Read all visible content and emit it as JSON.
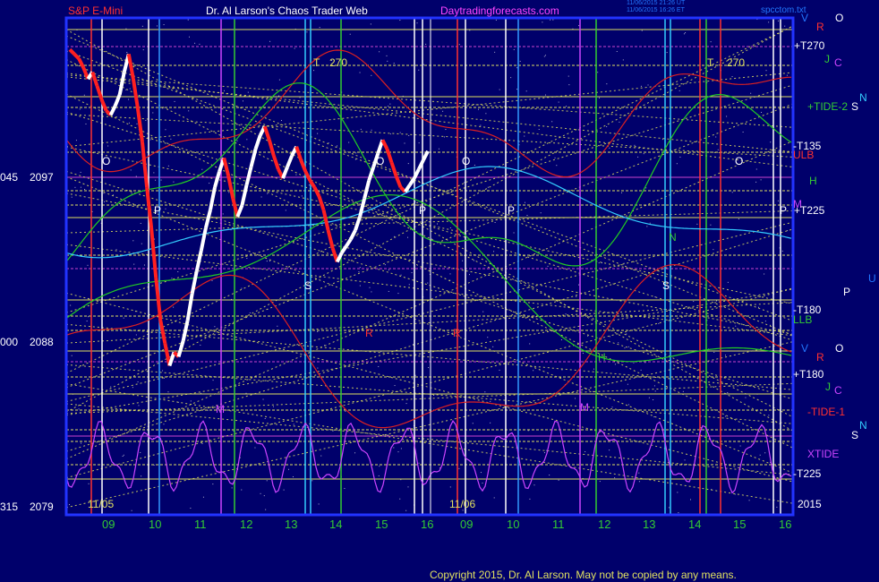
{
  "header": {
    "symbol": "S&P E-Mini",
    "title": "Dr. Al Larson's Chaos Trader Web",
    "site": "Daytradingforecasts.com",
    "timestamp_line1": "11/06/2015 21:26 UT",
    "timestamp_line2": "11/06/2015 16:26 ET",
    "file": "spcctom.txt"
  },
  "copyright": "Copyright 2015, Dr. Al Larson. May not be copied by any means.",
  "colors": {
    "background": "#00006b",
    "plot_border": "#2233ff",
    "grid_yellow": "#e0e060",
    "price_white": "#ffffff",
    "price_red": "#ff2020",
    "magenta": "#cc44ff",
    "red_line": "#dd2020",
    "green_line": "#22cc22",
    "cyan_line": "#33ccff"
  },
  "chart_data": {
    "type": "line",
    "title": "Dr. Al Larson's Chaos Trader Web",
    "ylabel": "",
    "y_ticks": [
      {
        "left": "045",
        "right": "2097"
      },
      {
        "left": "000",
        "right": "2088"
      },
      {
        "left": "315",
        "right": "2079"
      }
    ],
    "ylim": [
      2079,
      2101
    ],
    "x_tick_labels": [
      "09",
      "10",
      "11",
      "12",
      "13",
      "14",
      "15",
      "16",
      "09",
      "10",
      "11",
      "12",
      "13",
      "14",
      "15",
      "16"
    ],
    "date_labels": [
      "11/05",
      "11/06"
    ],
    "year_label": "2015",
    "price_series": {
      "name": "S&P E-Mini",
      "values": [
        2099.6,
        2099.4,
        2099.2,
        2098.8,
        2098.3,
        2098.6,
        2098.0,
        2097.4,
        2096.9,
        2096.7,
        2097.1,
        2097.6,
        2098.6,
        2099.4,
        2098.3,
        2097.0,
        2095.5,
        2093.5,
        2091.7,
        2089.5,
        2087.6,
        2086.6,
        2085.6,
        2086.2,
        2086.0,
        2086.7,
        2087.6,
        2088.8,
        2089.8,
        2090.7,
        2091.7,
        2092.5,
        2093.5,
        2094.2,
        2094.8,
        2094.0,
        2093.0,
        2092.2,
        2092.7,
        2093.6,
        2094.4,
        2095.2,
        2095.8,
        2096.2,
        2095.6,
        2094.9,
        2094.3,
        2093.9,
        2094.4,
        2094.9,
        2095.3,
        2094.7,
        2094.2,
        2093.8,
        2093.5,
        2093.1,
        2092.5,
        2091.6,
        2090.8,
        2090.2,
        2090.6,
        2090.9,
        2091.2,
        2091.6,
        2092.2,
        2093.0,
        2093.8,
        2094.4,
        2095.0,
        2095.6,
        2095.2,
        2094.6,
        2094.0,
        2093.5,
        2093.3,
        2093.6,
        2093.9,
        2094.3,
        2094.7,
        2095.1
      ]
    },
    "right_labels": [
      "V",
      "O",
      "R",
      "+T270",
      "J",
      "C",
      "N",
      "+TIDE-2",
      "S",
      "-T135",
      "ULB",
      "H",
      "M",
      "+T225",
      "P",
      "U",
      "P",
      "-T180",
      "LLB",
      "V",
      "O",
      "R",
      "+T180",
      "J",
      "C",
      "-TIDE-1",
      "N",
      "S",
      "XTIDE",
      "-T225"
    ],
    "plot_annotations": [
      "T",
      "270",
      "T",
      "270",
      "O",
      "O",
      "O",
      "O",
      "P",
      "P",
      "P",
      "R",
      "R",
      "M",
      "M",
      "H",
      "N",
      "S",
      "S"
    ]
  }
}
